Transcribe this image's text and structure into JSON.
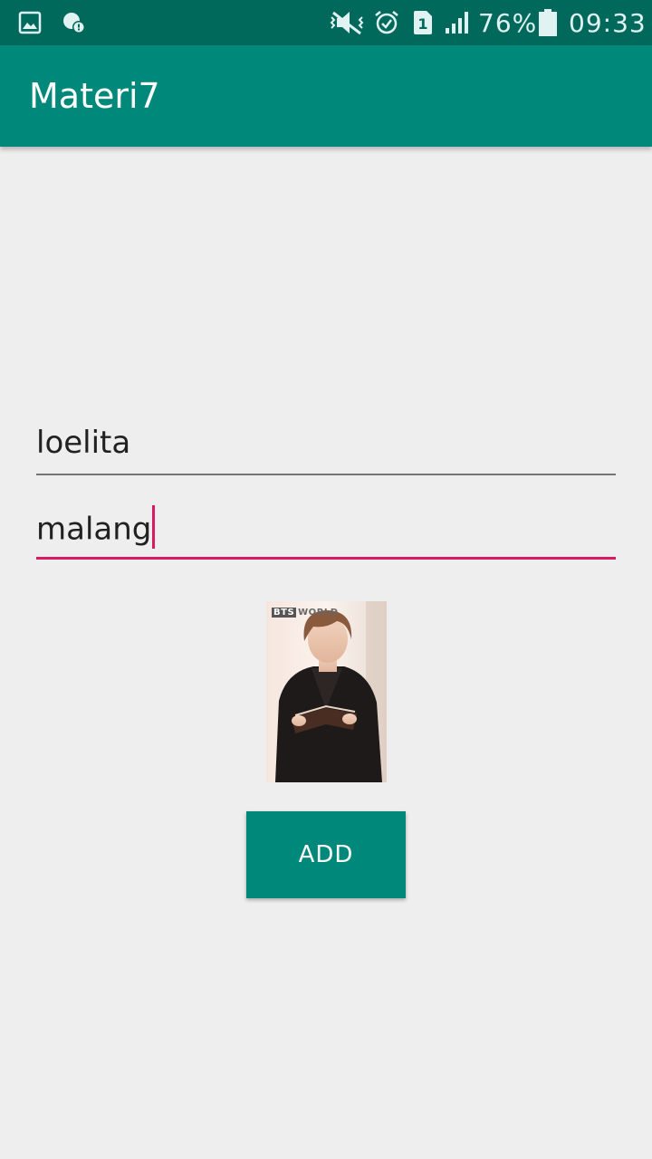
{
  "status_bar": {
    "battery_percent": "76%",
    "time": "09:33",
    "sim_slot": "1",
    "icons": [
      "gallery-notification-icon",
      "alert-notification-icon",
      "mute-icon",
      "alarm-icon",
      "sim-icon",
      "signal-icon",
      "battery-icon"
    ]
  },
  "app_bar": {
    "title": "Materi7"
  },
  "form": {
    "name_value": "loelita",
    "city_value": "malang",
    "add_label": "ADD"
  },
  "image": {
    "badge_bts": "BTS",
    "badge_world": "WORLD"
  },
  "colors": {
    "primary": "#00897b",
    "primary_dark": "#00695c",
    "accent": "#d81b60",
    "background": "#eeeeee"
  }
}
